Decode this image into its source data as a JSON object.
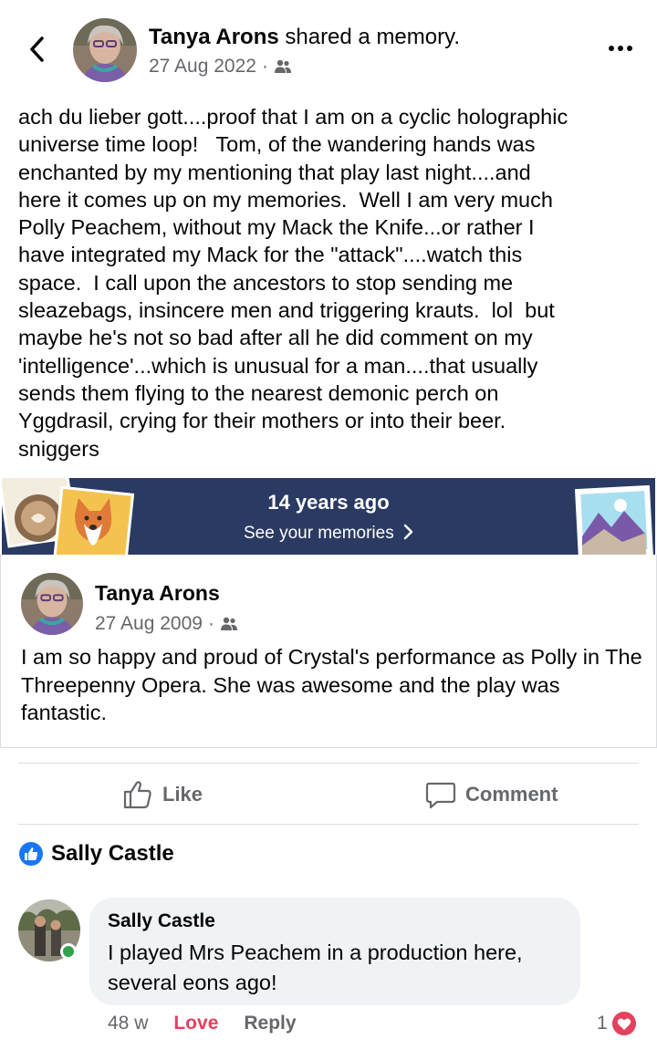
{
  "header": {
    "author": "Tanya Arons",
    "action": " shared a memory.",
    "date": "27 Aug 2022",
    "separator": "·",
    "audience_icon": "friends-icon",
    "more_icon": "more-options-icon",
    "back_icon": "back-chevron-icon"
  },
  "post": {
    "text": "ach du lieber gott....proof that I am on a cyclic holographic\nuniverse time loop!   Tom, of the wandering hands was\nenchanted by my mentioning that play last night....and\nhere it comes up on my memories.  Well I am very much\nPolly Peachem, without my Mack the Knife...or rather I\nhave integrated my Mack for the \"attack\"....watch this\nspace.  I call upon the ancestors to stop sending me\nsleazebags, insincere men and triggering krauts.  lol  but\nmaybe he's not so bad after all he did comment on my\n'intelligence'...which is unusual for a man....that usually\nsends them flying to the nearest demonic perch on\nYggdrasil, crying for their mothers or into their beer.\nsniggers"
  },
  "memory_banner": {
    "title": "14 years ago",
    "link": "See your memories",
    "link_icon": "chevron-right-icon",
    "colors": {
      "background": "#2a3a62"
    }
  },
  "shared_post": {
    "author": "Tanya Arons",
    "date": "27 Aug 2009",
    "separator": "·",
    "text": "I am so happy and proud of Crystal's performance as Polly in The Threepenny Opera.  She was awesome and the play was fantastic."
  },
  "actions": {
    "like": "Like",
    "comment": "Comment"
  },
  "reactions": {
    "liker_name": "Sally Castle",
    "icon": "like-reaction-icon",
    "color": "#1877f2"
  },
  "comment": {
    "author": "Sally Castle",
    "text": "I played Mrs Peachem in a production here, several eons ago!",
    "time": "48 w",
    "love_label": "Love",
    "reply_label": "Reply",
    "reaction_count": "1",
    "reaction_icon": "love-reaction-icon",
    "love_color": "#e4405f"
  }
}
